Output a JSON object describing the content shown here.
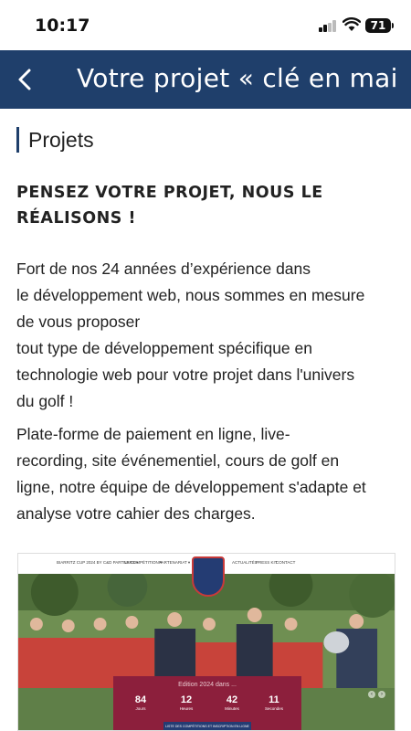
{
  "status_bar": {
    "time": "10:17",
    "battery": "71"
  },
  "nav": {
    "title": "Votre projet « clé en mai..."
  },
  "page": {
    "section_title": "Projets",
    "headline_lines": [
      "PENSEZ VOTRE PROJET, NOUS LE",
      "RÉALISONS !"
    ],
    "para1_lines": [
      "Fort de nos 24 années d’expérience dans",
      "le développement web, nous sommes en mesure",
      "de vous proposer",
      "tout type de développement spécifique en",
      "technologie web pour votre projet dans l'univers",
      "du golf !"
    ],
    "para2_lines": [
      "Plate-forme de paiement en ligne, live-",
      "recording, site événementiel, cours de golf en",
      "ligne, notre équipe de développement s'adapte et",
      "analyse votre cahier des charges."
    ]
  },
  "hero": {
    "nav_links": [
      "BIARRITZ CUP 2024 BY C&D PARTNERS ▾",
      "LA COMPÉTITION ▾",
      "PARTENARIAT ▾",
      "ACTUALITÉS",
      "PRESS KIT",
      "CONTACT"
    ],
    "countdown_title": "Edition 2024 dans ...",
    "countdown": [
      {
        "num": "84",
        "label": "Jours"
      },
      {
        "num": "12",
        "label": "Heures"
      },
      {
        "num": "42",
        "label": "Minutes"
      },
      {
        "num": "11",
        "label": "Secondes"
      }
    ],
    "cta": "LISTE DES COMPÉTITIONS ET INSCRIPTION EN LIGNE"
  }
}
